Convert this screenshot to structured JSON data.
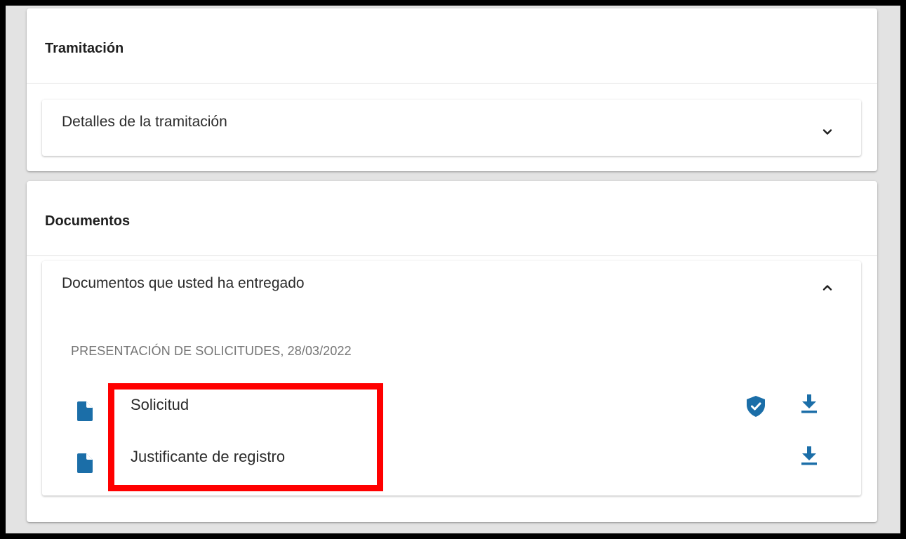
{
  "tramitacion": {
    "title": "Tramitación",
    "panel_title": "Detalles de la tramitación",
    "expanded": false
  },
  "documentos": {
    "title": "Documentos",
    "panel_title": "Documentos que usted ha entregado",
    "expanded": true,
    "section_label": "PRESENTACIÓN DE SOLICITUDES,  28/03/2022",
    "items": [
      {
        "name": "Solicitud",
        "has_signature": true,
        "file_icon": "file-icon",
        "signature_icon": "shield-check-icon",
        "download_icon": "download-icon"
      },
      {
        "name": "Justificante de registro",
        "has_signature": false,
        "file_icon": "file-icon",
        "download_icon": "download-icon"
      }
    ]
  },
  "colors": {
    "accent": "#1b6ea8",
    "highlight": "#ff0000",
    "background": "#e3e3e3"
  }
}
